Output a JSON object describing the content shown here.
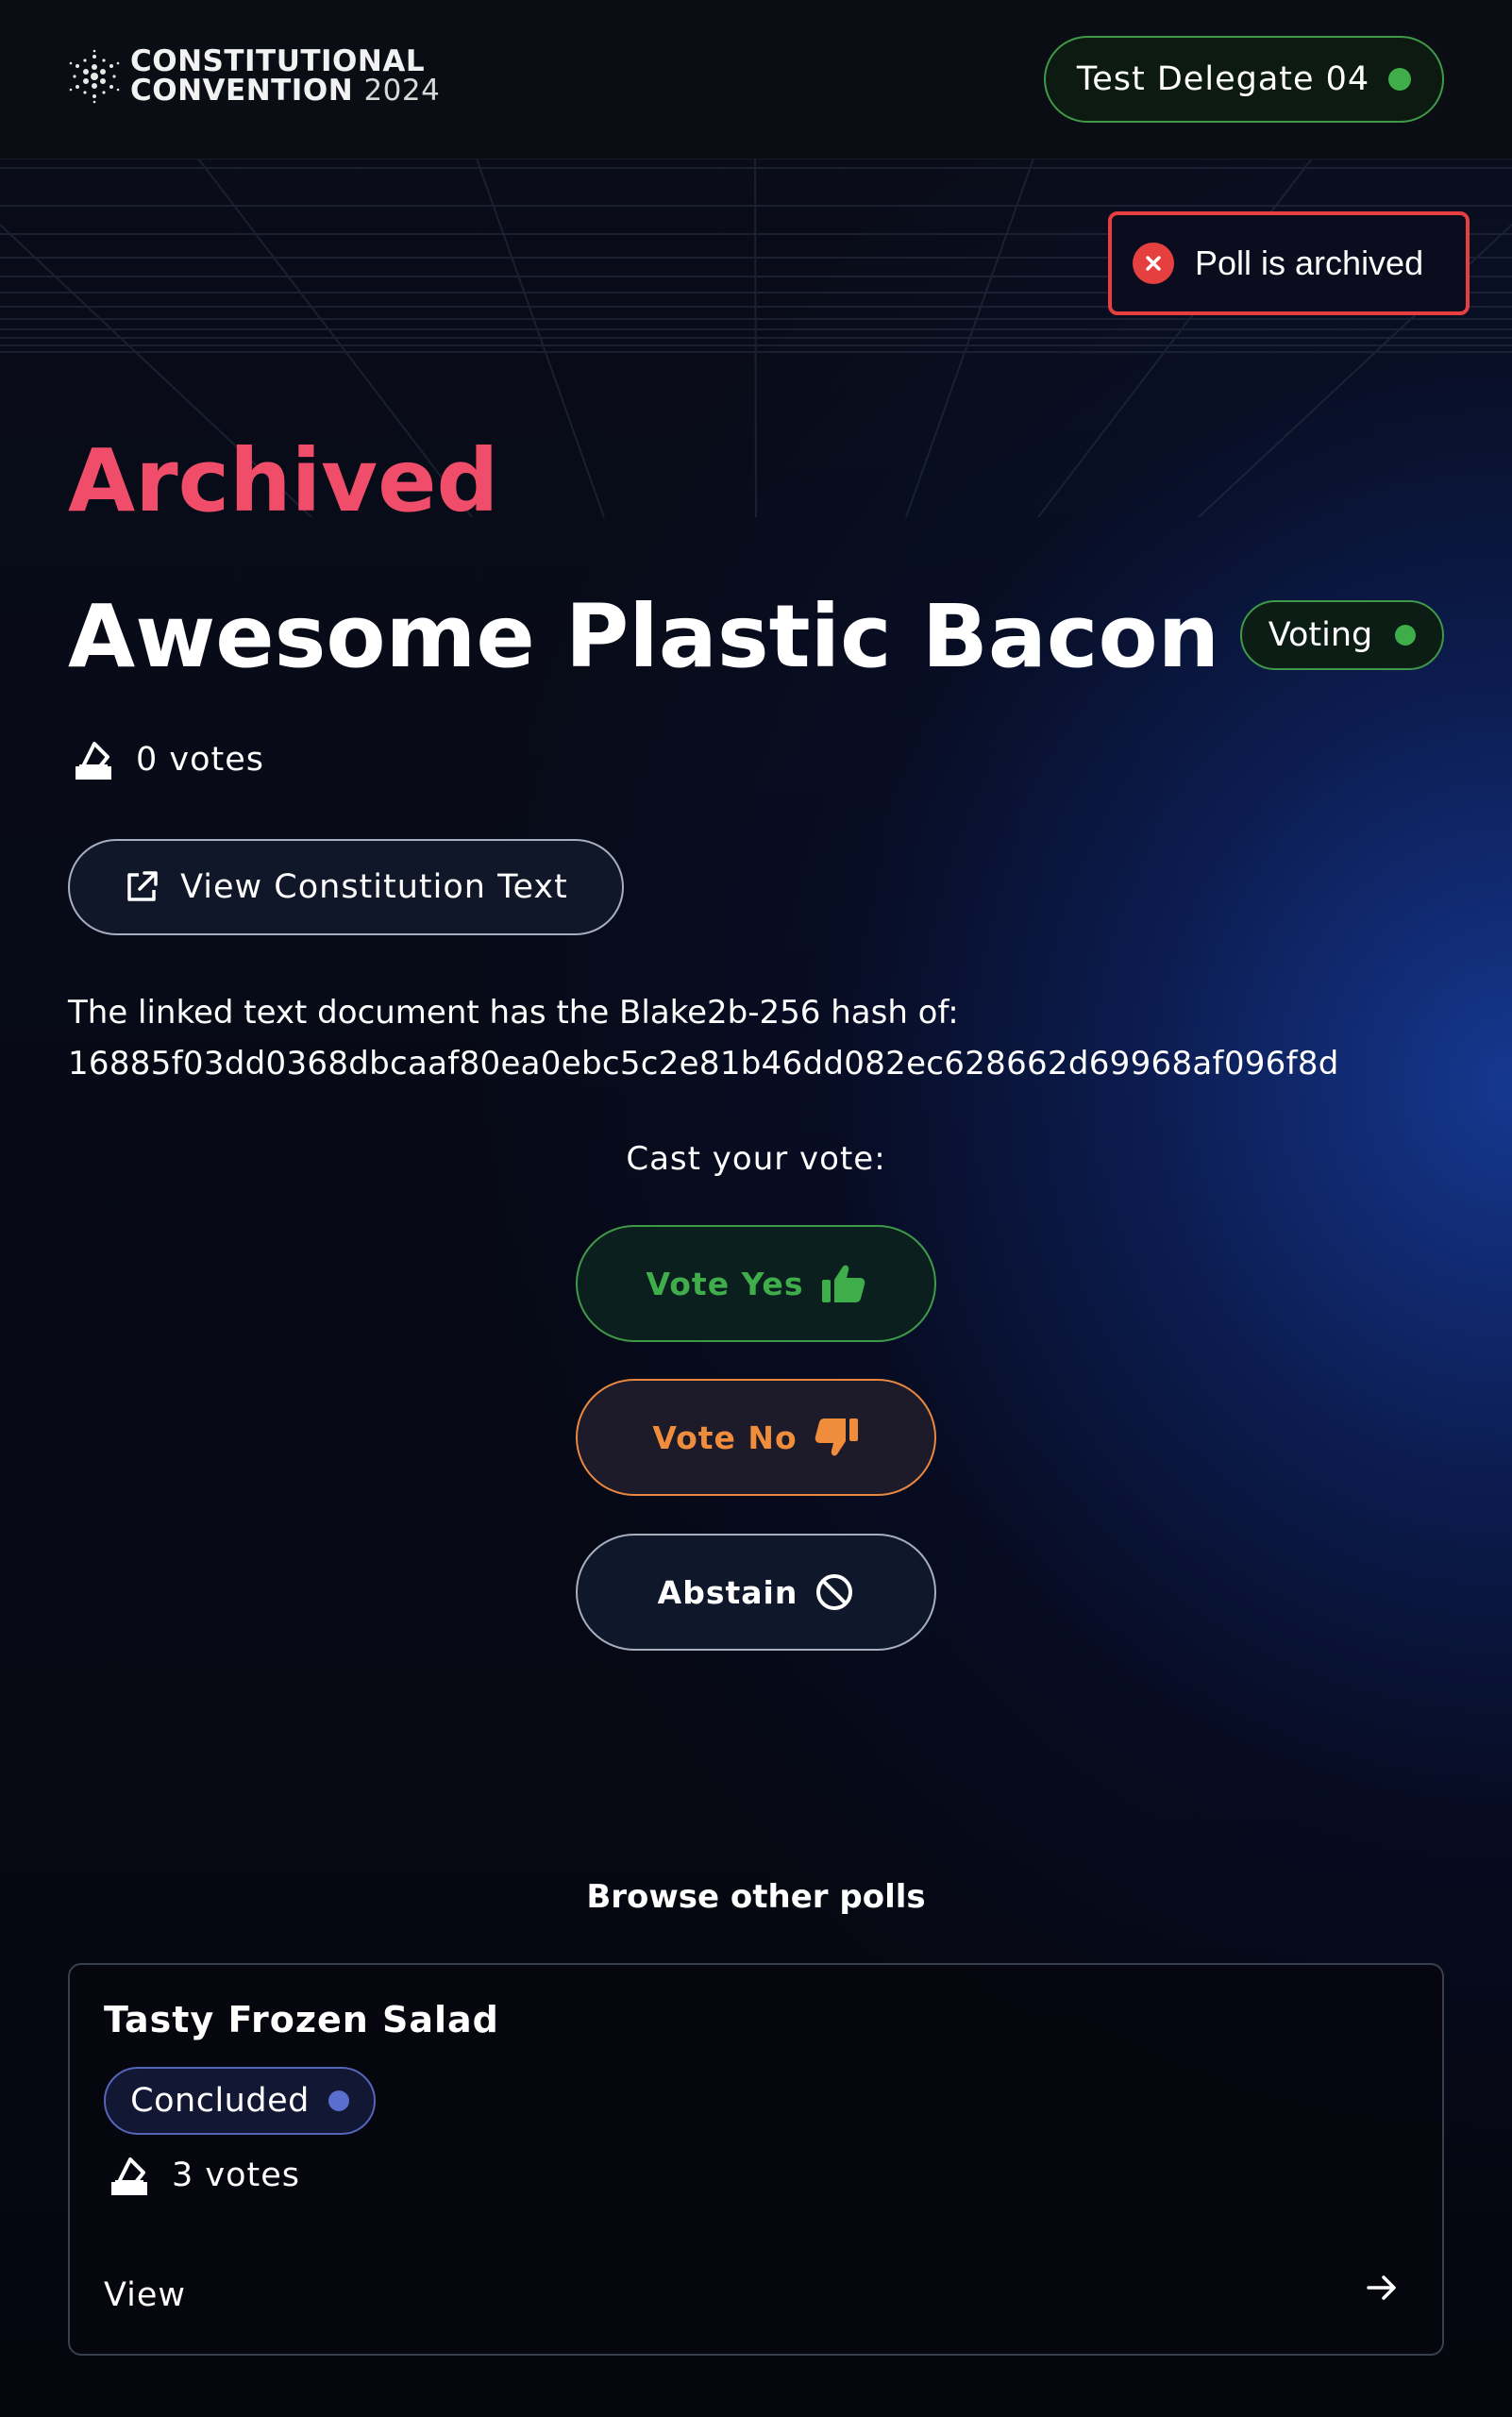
{
  "header": {
    "logo_line1": "CONSTITUTIONAL",
    "logo_line2": "CONVENTION",
    "logo_year": "2024",
    "delegate_name": "Test Delegate 04"
  },
  "toast": {
    "message": "Poll is archived",
    "icon": "close-icon"
  },
  "poll": {
    "status_heading": "Archived",
    "title": "Awesome Plastic Bacon",
    "status_badge": "Voting",
    "votes": "0 votes",
    "view_constitution_label": "View Constitution Text",
    "hash_label": "The linked text document has the Blake2b-256 hash of:",
    "hash_value": "16885f03dd0368dbcaaf80ea0ebc5c2e81b46dd082ec628662d69968af096f8d"
  },
  "vote": {
    "cast_label": "Cast your vote:",
    "yes_label": "Vote Yes",
    "no_label": "Vote No",
    "abstain_label": "Abstain"
  },
  "browse": {
    "heading": "Browse other polls",
    "polls": [
      {
        "title": "Tasty Frozen Salad",
        "status": "Concluded",
        "votes": "3 votes",
        "view_label": "View"
      }
    ]
  },
  "colors": {
    "archived_accent": "#f04d6a",
    "voting_green": "#3fae4a",
    "vote_no_orange": "#f08d3c",
    "error_red": "#e5403f",
    "concluded_blue": "#5a6ed0"
  }
}
